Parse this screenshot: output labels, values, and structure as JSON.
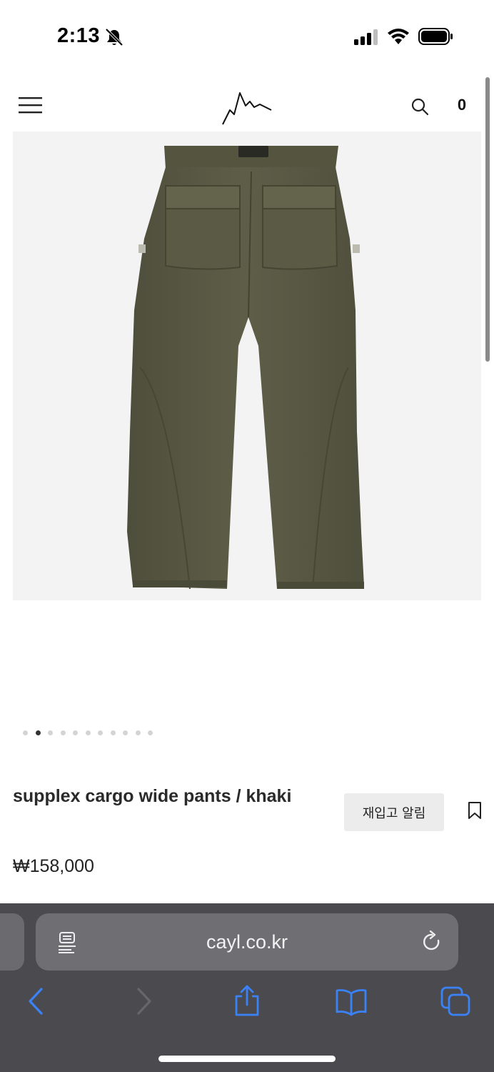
{
  "status_bar": {
    "time": "2:13",
    "icons": [
      "bell-slash-icon",
      "cellular-signal-icon",
      "wifi-icon",
      "battery-icon"
    ]
  },
  "header": {
    "menu_icon": "hamburger-menu-icon",
    "logo_icon": "mountain-logo-icon",
    "search_icon": "search-icon",
    "cart_count": "0"
  },
  "product": {
    "image_description_icon": "khaki-pants-image",
    "name": "supplex cargo wide pants / khaki",
    "price": "₩158,000",
    "restock_button_label": "재입고 알림",
    "bookmark_icon": "bookmark-icon",
    "carousel": {
      "total": 11,
      "active_index": 1
    }
  },
  "browser": {
    "url": "cayl.co.kr",
    "reader_icon": "reader-mode-icon",
    "reload_icon": "reload-icon",
    "toolbar_icons": [
      "back-icon",
      "forward-icon",
      "share-icon",
      "bookmarks-icon",
      "tabs-icon"
    ]
  },
  "colors": {
    "accent_blue": "#3b82f6",
    "pants_khaki": "#5a5a44",
    "toolbar_bg": "#4b4b4f"
  }
}
